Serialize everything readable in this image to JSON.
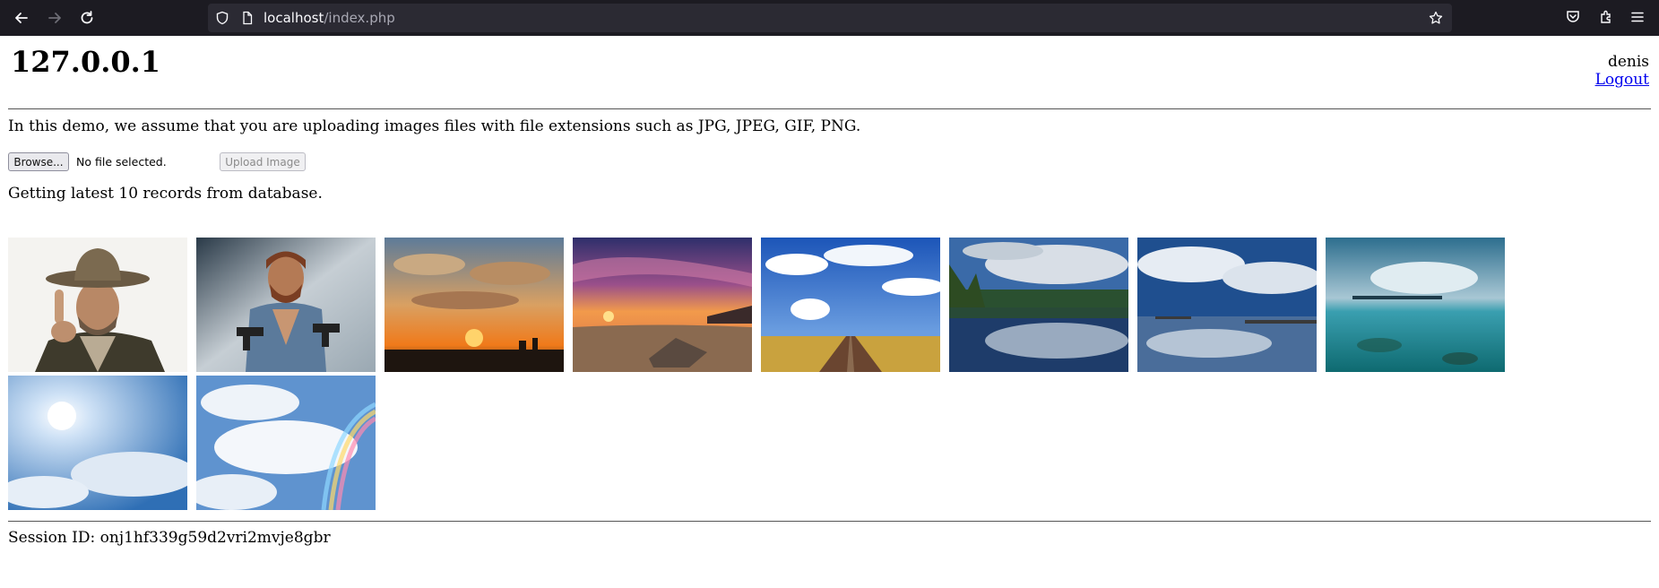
{
  "browser": {
    "url_host": "localhost",
    "url_path": "/index.php",
    "icons": [
      "back-icon",
      "forward-icon",
      "reload-icon",
      "shield-icon",
      "page-icon",
      "bookmark-star-icon",
      "pocket-icon",
      "extensions-icon",
      "menu-icon"
    ]
  },
  "header": {
    "site_title": "127.0.0.1",
    "username": "denis",
    "logout_label": "Logout"
  },
  "main": {
    "intro_text": "In this demo, we assume that you are uploading images files with file extensions such as JPG, JPEG, GIF, PNG.",
    "browse_label": "Browse...",
    "file_status": "No file selected.",
    "upload_label": "Upload Image",
    "records_text": "Getting latest 10 records from database."
  },
  "gallery": {
    "images": [
      "man-in-cowboy-hat",
      "man-with-guns",
      "sunset-clouds-city",
      "beach-sunset-rock",
      "road-to-horizon-clouds",
      "lake-forest-reflection",
      "pier-cloud-reflection",
      "turquoise-sea-clouds",
      "sun-rays-clouds",
      "rainbow-clouds"
    ]
  },
  "footer": {
    "session_text": "Session ID: onj1hf339g59d2vri2mvje8gbr"
  }
}
